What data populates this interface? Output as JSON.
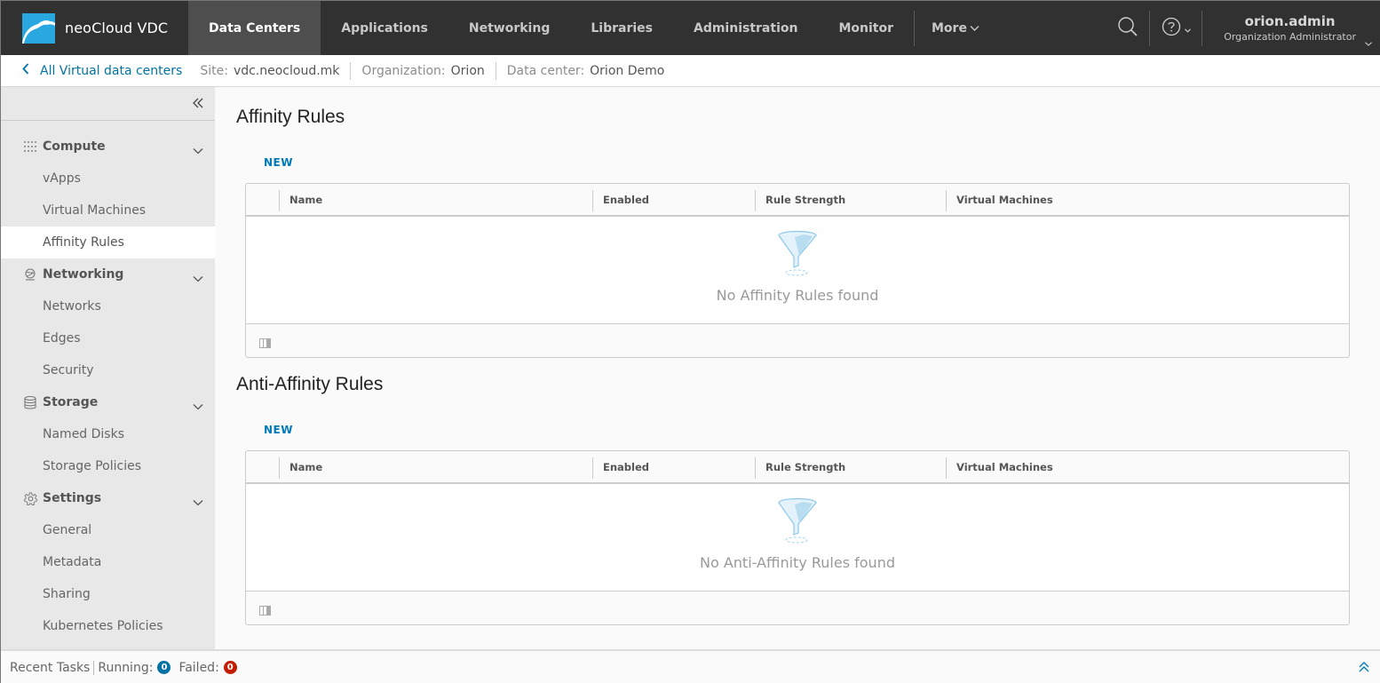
{
  "header": {
    "brand": "neoCloud VDC",
    "nav": [
      {
        "label": "Data Centers",
        "active": true
      },
      {
        "label": "Applications",
        "active": false
      },
      {
        "label": "Networking",
        "active": false
      },
      {
        "label": "Libraries",
        "active": false
      },
      {
        "label": "Administration",
        "active": false
      },
      {
        "label": "Monitor",
        "active": false
      }
    ],
    "more_label": "More",
    "user": {
      "name": "orion.admin",
      "role": "Organization Administrator"
    },
    "icons": {
      "search": "search-icon",
      "help": "help-icon",
      "chevron": "chevron-down-icon"
    }
  },
  "breadcrumb": {
    "back_label": "All Virtual data centers",
    "site_label": "Site:",
    "site_value": "vdc.neocloud.mk",
    "org_label": "Organization:",
    "org_value": "Orion",
    "dc_label": "Data center:",
    "dc_value": "Orion Demo"
  },
  "sidebar": {
    "groups": [
      {
        "label": "Compute",
        "icon": "grid-icon",
        "items": [
          "vApps",
          "Virtual Machines",
          "Affinity Rules"
        ]
      },
      {
        "label": "Networking",
        "icon": "network-icon",
        "items": [
          "Networks",
          "Edges",
          "Security"
        ]
      },
      {
        "label": "Storage",
        "icon": "database-icon",
        "items": [
          "Named Disks",
          "Storage Policies"
        ]
      },
      {
        "label": "Settings",
        "icon": "gear-icon",
        "items": [
          "General",
          "Metadata",
          "Sharing",
          "Kubernetes Policies"
        ]
      }
    ],
    "active_item": "Affinity Rules"
  },
  "main": {
    "sections": [
      {
        "title": "Affinity Rules",
        "new_label": "NEW",
        "columns": [
          "Name",
          "Enabled",
          "Rule Strength",
          "Virtual Machines"
        ],
        "empty_text": "No Affinity Rules found"
      },
      {
        "title": "Anti-Affinity Rules",
        "new_label": "NEW",
        "columns": [
          "Name",
          "Enabled",
          "Rule Strength",
          "Virtual Machines"
        ],
        "empty_text": "No Anti-Affinity Rules found"
      }
    ]
  },
  "footer": {
    "recent_tasks": "Recent Tasks",
    "running_label": "Running:",
    "running_count": "0",
    "failed_label": "Failed:",
    "failed_count": "0"
  },
  "colors": {
    "header_bg": "#313131",
    "accent": "#0079b8",
    "running_badge": "#0072a3",
    "failed_badge": "#c21d00"
  }
}
